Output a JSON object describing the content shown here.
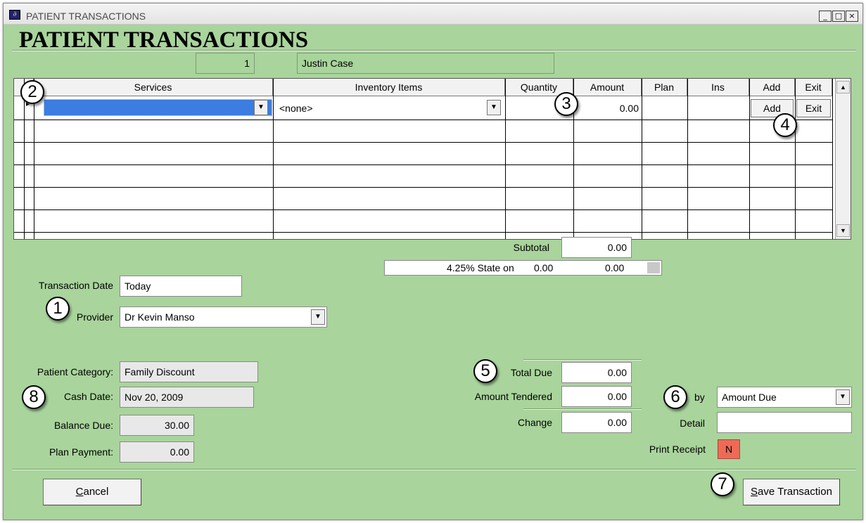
{
  "window": {
    "title_bar": "PATIENT TRANSACTIONS",
    "heading": "PATIENT TRANSACTIONS",
    "minimize": "_",
    "maximize": "□",
    "close": "×"
  },
  "patient": {
    "number": "1",
    "name": "Justin Case"
  },
  "grid": {
    "columns": [
      "Services",
      "Inventory Items",
      "Quantity",
      "Amount",
      "Plan",
      "Ins",
      "Add",
      "Exit"
    ],
    "row": {
      "service": "",
      "inventory": "<none>",
      "quantity": "",
      "amount": "0.00",
      "plan": "",
      "ins": "",
      "add_button": "Add",
      "exit_button": "Exit"
    },
    "row_marker": "▸",
    "scroll_up": "▲",
    "scroll_down": "▼",
    "dropdown_arrow": "▼"
  },
  "subtotal": {
    "label": "Subtotal",
    "value": "0.00"
  },
  "tax": {
    "text": "4.25% State on",
    "base": "0.00",
    "value": "0.00"
  },
  "transaction_date": {
    "label": "Transaction Date",
    "value": "Today"
  },
  "provider": {
    "label": "Provider",
    "value": "Dr Kevin Manso"
  },
  "patient_category": {
    "label": "Patient Category:",
    "value": "Family Discount"
  },
  "cash_date": {
    "label": "Cash Date:",
    "value": "Nov 20, 2009"
  },
  "balance_due": {
    "label": "Balance Due:",
    "value": "30.00"
  },
  "plan_payment": {
    "label": "Plan Payment:",
    "value": "0.00"
  },
  "total_due": {
    "label": "Total Due",
    "value": "0.00"
  },
  "amount_tendered": {
    "label": "Amount Tendered",
    "value": "0.00"
  },
  "change": {
    "label": "Change",
    "value": "0.00"
  },
  "payment_by": {
    "label": "by",
    "value": "Amount Due"
  },
  "detail": {
    "label": "Detail",
    "value": ""
  },
  "print_receipt": {
    "label": "Print Receipt",
    "value": "N"
  },
  "buttons": {
    "cancel_u": "C",
    "cancel_rest": "ancel",
    "save_u": "S",
    "save_rest": "ave Transaction"
  },
  "callouts": [
    "1",
    "2",
    "3",
    "4",
    "5",
    "6",
    "7",
    "8"
  ],
  "colors": {
    "background": "#a9d49c",
    "selection": "#3b7de0",
    "print_flag": "#ee6a56"
  }
}
